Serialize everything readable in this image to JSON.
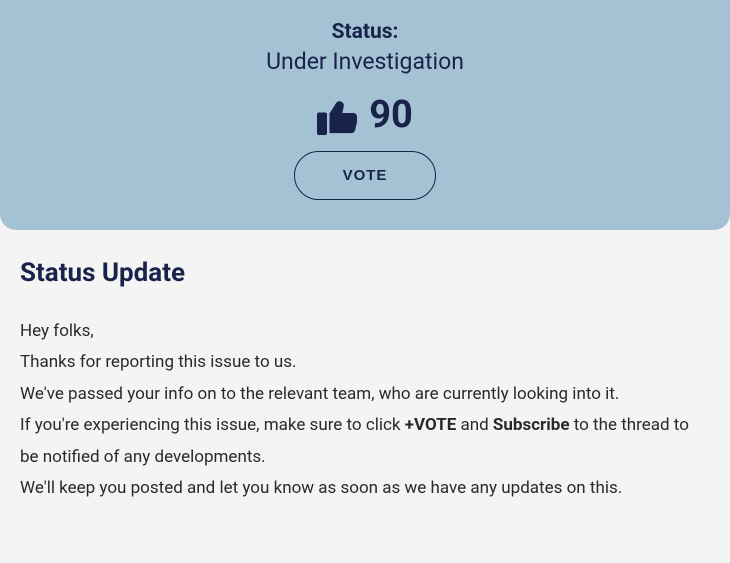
{
  "status": {
    "label": "Status:",
    "value": "Under Investigation",
    "vote_count": "90",
    "vote_button_label": "VOTE"
  },
  "update": {
    "heading": "Status Update",
    "greeting": "Hey folks,",
    "line1": "Thanks for reporting this issue to us.",
    "line2": "We've passed your info on to the relevant team, who are currently looking into it.",
    "line3_a": "If you're experiencing this issue, make sure to click ",
    "line3_vote": "+VOTE",
    "line3_b": " and ",
    "line3_sub": "Subscribe",
    "line3_c": " to the thread to be notified of any developments.",
    "line4": "We'll keep you posted and let you know as soon as we have any updates on this."
  },
  "colors": {
    "card_bg": "#a4c2d3",
    "ink": "#19224a"
  }
}
